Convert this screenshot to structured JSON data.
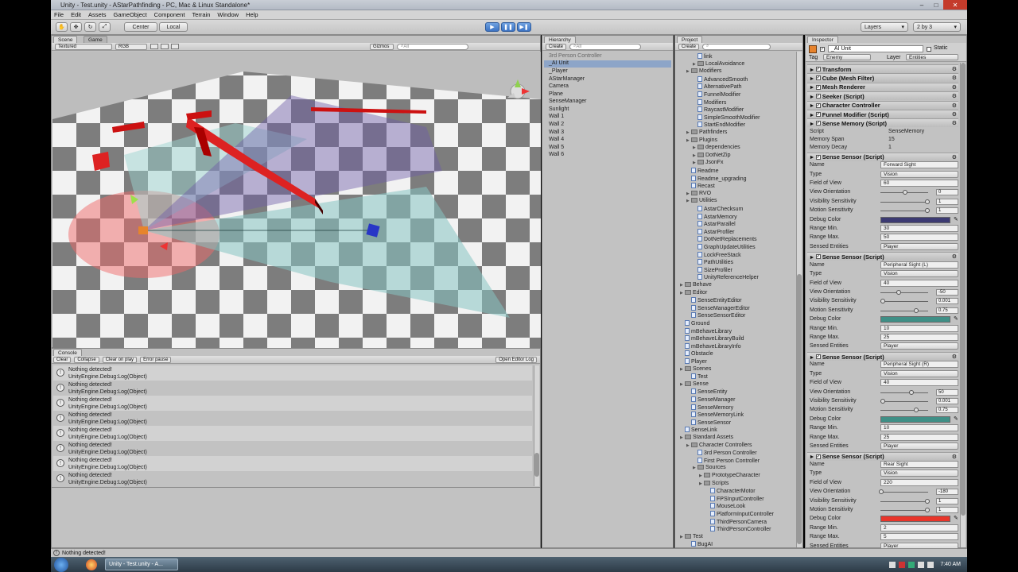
{
  "window": {
    "title": "Unity - Test.unity - AStarPathfinding - PC, Mac & Linux Standalone*"
  },
  "menu": [
    "File",
    "Edit",
    "Assets",
    "GameObject",
    "Component",
    "Terrain",
    "Window",
    "Help"
  ],
  "toolbar": {
    "center_label": "Center",
    "local_label": "Local",
    "layers_label": "Layers",
    "layout_label": "2 by 3"
  },
  "scene": {
    "tab_scene": "Scene",
    "tab_game": "Game",
    "render_mode": "Textured",
    "color_mode": "RGB",
    "gizmos_label": "Gizmos",
    "search_placeholder": "All"
  },
  "console": {
    "tab": "Console",
    "buttons": [
      "Clear",
      "Collapse",
      "Clear on play",
      "Error pause"
    ],
    "open_editor_log": "Open Editor Log",
    "entries": [
      {
        "line1": "Nothing detected!",
        "line2": "UnityEngine.Debug:Log(Object)"
      },
      {
        "line1": "Nothing detected!",
        "line2": "UnityEngine.Debug:Log(Object)"
      },
      {
        "line1": "Nothing detected!",
        "line2": "UnityEngine.Debug:Log(Object)"
      },
      {
        "line1": "Nothing detected!",
        "line2": "UnityEngine.Debug:Log(Object)"
      },
      {
        "line1": "Nothing detected!",
        "line2": "UnityEngine.Debug:Log(Object)"
      },
      {
        "line1": "Nothing detected!",
        "line2": "UnityEngine.Debug:Log(Object)"
      },
      {
        "line1": "Nothing detected!",
        "line2": "UnityEngine.Debug:Log(Object)"
      },
      {
        "line1": "Nothing detected!",
        "line2": "UnityEngine.Debug:Log(Object)"
      }
    ]
  },
  "hierarchy": {
    "tab": "Hierarchy",
    "create_label": "Create",
    "search_placeholder": "All",
    "items": [
      "3rd Person Controller",
      "_AI Unit",
      "_Player",
      "AStarManager",
      "Camera",
      "Plane",
      "SenseManager",
      "Sunlight",
      "Wall 1",
      "Wall 2",
      "Wall 3",
      "Wall 4",
      "Wall 5",
      "Wall 6"
    ]
  },
  "project": {
    "tab": "Project",
    "create_label": "Create",
    "items": [
      {
        "label": "link",
        "indent": 2,
        "kind": "script"
      },
      {
        "label": "LocalAvoidance",
        "indent": 2,
        "kind": "folder"
      },
      {
        "label": "Modifiers",
        "indent": 1,
        "kind": "folder"
      },
      {
        "label": "AdvancedSmooth",
        "indent": 2,
        "kind": "script"
      },
      {
        "label": "AlternativePath",
        "indent": 2,
        "kind": "script"
      },
      {
        "label": "FunnelModifier",
        "indent": 2,
        "kind": "script"
      },
      {
        "label": "Modifiers",
        "indent": 2,
        "kind": "script"
      },
      {
        "label": "RaycastModifier",
        "indent": 2,
        "kind": "script"
      },
      {
        "label": "SimpleSmoothModifier",
        "indent": 2,
        "kind": "script"
      },
      {
        "label": "StartEndModifier",
        "indent": 2,
        "kind": "script"
      },
      {
        "label": "Pathfinders",
        "indent": 1,
        "kind": "folder"
      },
      {
        "label": "Plugins",
        "indent": 1,
        "kind": "folder"
      },
      {
        "label": "dependencies",
        "indent": 2,
        "kind": "folder"
      },
      {
        "label": "DotNetZip",
        "indent": 2,
        "kind": "folder"
      },
      {
        "label": "JsonFx",
        "indent": 2,
        "kind": "folder"
      },
      {
        "label": "Readme",
        "indent": 1,
        "kind": "script"
      },
      {
        "label": "Readme_upgrading",
        "indent": 1,
        "kind": "script"
      },
      {
        "label": "Recast",
        "indent": 1,
        "kind": "script"
      },
      {
        "label": "RVO",
        "indent": 1,
        "kind": "folder"
      },
      {
        "label": "Utilities",
        "indent": 1,
        "kind": "folder"
      },
      {
        "label": "AstarChecksum",
        "indent": 2,
        "kind": "script"
      },
      {
        "label": "AstarMemory",
        "indent": 2,
        "kind": "script"
      },
      {
        "label": "AstarParallel",
        "indent": 2,
        "kind": "script"
      },
      {
        "label": "AstarProfiler",
        "indent": 2,
        "kind": "script"
      },
      {
        "label": "DotNetReplacements",
        "indent": 2,
        "kind": "script"
      },
      {
        "label": "GraphUpdateUtilities",
        "indent": 2,
        "kind": "script"
      },
      {
        "label": "LockFreeStack",
        "indent": 2,
        "kind": "script"
      },
      {
        "label": "PathUtilities",
        "indent": 2,
        "kind": "script"
      },
      {
        "label": "SizeProfiler",
        "indent": 2,
        "kind": "script"
      },
      {
        "label": "UnityReferenceHelper",
        "indent": 2,
        "kind": "script"
      },
      {
        "label": "Behave",
        "indent": 0,
        "kind": "folder"
      },
      {
        "label": "Editor",
        "indent": 0,
        "kind": "folder"
      },
      {
        "label": "SenseEntityEditor",
        "indent": 1,
        "kind": "script"
      },
      {
        "label": "SenseManagerEditor",
        "indent": 1,
        "kind": "script"
      },
      {
        "label": "SenseSensorEditor",
        "indent": 1,
        "kind": "script"
      },
      {
        "label": "Ground",
        "indent": 0,
        "kind": "script"
      },
      {
        "label": "mBehaveLibrary",
        "indent": 0,
        "kind": "script"
      },
      {
        "label": "mBehaveLibraryBuild",
        "indent": 0,
        "kind": "script"
      },
      {
        "label": "mBehaveLibraryInfo",
        "indent": 0,
        "kind": "script"
      },
      {
        "label": "Obstacle",
        "indent": 0,
        "kind": "script"
      },
      {
        "label": "Player",
        "indent": 0,
        "kind": "script"
      },
      {
        "label": "Scenes",
        "indent": 0,
        "kind": "folder"
      },
      {
        "label": "Test",
        "indent": 1,
        "kind": "script"
      },
      {
        "label": "Sense",
        "indent": 0,
        "kind": "folder"
      },
      {
        "label": "SenseEntity",
        "indent": 1,
        "kind": "script"
      },
      {
        "label": "SenseManager",
        "indent": 1,
        "kind": "script"
      },
      {
        "label": "SenseMemory",
        "indent": 1,
        "kind": "script"
      },
      {
        "label": "SenseMemoryLink",
        "indent": 1,
        "kind": "script"
      },
      {
        "label": "SenseSensor",
        "indent": 1,
        "kind": "script"
      },
      {
        "label": "SenseLink",
        "indent": 0,
        "kind": "script"
      },
      {
        "label": "Standard Assets",
        "indent": 0,
        "kind": "folder"
      },
      {
        "label": "Character Controllers",
        "indent": 1,
        "kind": "folder"
      },
      {
        "label": "3rd Person Controller",
        "indent": 2,
        "kind": "script"
      },
      {
        "label": "First Person Controller",
        "indent": 2,
        "kind": "script"
      },
      {
        "label": "Sources",
        "indent": 2,
        "kind": "folder"
      },
      {
        "label": "PrototypeCharacter",
        "indent": 3,
        "kind": "folder"
      },
      {
        "label": "Scripts",
        "indent": 3,
        "kind": "folder"
      },
      {
        "label": "CharacterMotor",
        "indent": 4,
        "kind": "script"
      },
      {
        "label": "FPSInputController",
        "indent": 4,
        "kind": "script"
      },
      {
        "label": "MouseLook",
        "indent": 4,
        "kind": "script"
      },
      {
        "label": "PlatformInputController",
        "indent": 4,
        "kind": "script"
      },
      {
        "label": "ThirdPersonCamera",
        "indent": 4,
        "kind": "script"
      },
      {
        "label": "ThirdPersonController",
        "indent": 4,
        "kind": "script"
      },
      {
        "label": "Test",
        "indent": 0,
        "kind": "folder"
      },
      {
        "label": "BugAI",
        "indent": 1,
        "kind": "script"
      }
    ]
  },
  "inspector": {
    "tab": "Inspector",
    "object_name": "_AI Unit",
    "static_label": "Static",
    "tag_label": "Tag",
    "tag_value": "Enemy",
    "layer_label": "Layer",
    "layer_value": "Entities",
    "components": [
      "Transform",
      "Cube (Mesh Filter)",
      "Mesh Renderer",
      "Seeker (Script)",
      "Character Controller",
      "Funnel Modifier (Script)",
      "Sense Memory (Script)"
    ],
    "memory": {
      "script_label": "Script",
      "script_value": "SenseMemory",
      "span_label": "Memory Span",
      "span_value": "15",
      "decay_label": "Memory Decay",
      "decay_value": "1"
    },
    "field_labels": {
      "header": "Sense Sensor (Script)",
      "name": "Name",
      "type": "Type",
      "fov": "Field of View",
      "orient": "View Orientation",
      "vis": "Visibility Sensitivity",
      "motion": "Motion Sensitivity",
      "color": "Debug Color",
      "rmin": "Range Min.",
      "rmax": "Range Max.",
      "entities": "Sensed Entities"
    },
    "sensors": [
      {
        "name": "Forward Sight",
        "type": "Vision",
        "fov": "60",
        "orient": "0",
        "vis": "1",
        "motion": "1",
        "color": "#3c3a72",
        "rmin": "30",
        "rmax": "50",
        "entities": "Player"
      },
      {
        "name": "Peripheral Sight (L)",
        "type": "Vision",
        "fov": "40",
        "orient": "-50",
        "vis": "0.001",
        "motion": "0.75",
        "color": "#3f8f86",
        "rmin": "10",
        "rmax": "25",
        "entities": "Player"
      },
      {
        "name": "Peripheral Sight (R)",
        "type": "Vision",
        "fov": "40",
        "orient": "50",
        "vis": "0.001",
        "motion": "0.75",
        "color": "#3f8f86",
        "rmin": "10",
        "rmax": "25",
        "entities": "Player"
      },
      {
        "name": "Rear Sight",
        "type": "Vision",
        "fov": "220",
        "orient": "-180",
        "vis": "1",
        "motion": "1",
        "color": "#e8352a",
        "rmin": "2",
        "rmax": "5",
        "entities": "Player"
      }
    ]
  },
  "status": {
    "message": "Nothing detected!"
  },
  "taskbar": {
    "window_label": "Unity - Test.unity - A...",
    "time": "7:40 AM"
  }
}
